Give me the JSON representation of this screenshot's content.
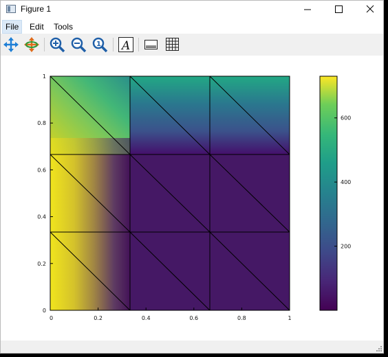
{
  "window": {
    "title": "Figure 1"
  },
  "menubar": {
    "items": [
      "File",
      "Edit",
      "Tools"
    ]
  },
  "toolbar": {
    "icons": [
      "pan-icon",
      "rotate-icon",
      "zoom-in-icon",
      "zoom-out-icon",
      "zoom-reset-icon",
      "text-icon",
      "colorbar-icon",
      "grid-icon"
    ]
  },
  "chart_data": {
    "type": "heatmap",
    "x_ticks": [
      "0",
      "0.2",
      "0.4",
      "0.6",
      "0.8",
      "1"
    ],
    "y_ticks": [
      "0",
      "0.2",
      "0.4",
      "0.6",
      "0.8",
      "1"
    ],
    "xlim": [
      0,
      1
    ],
    "ylim": [
      0,
      1
    ],
    "colorbar": {
      "ticks": [
        "200",
        "400",
        "600"
      ],
      "range": [
        0,
        730
      ],
      "colormap": "viridis"
    },
    "mesh": {
      "divisions": 3,
      "triangulated": true
    }
  }
}
